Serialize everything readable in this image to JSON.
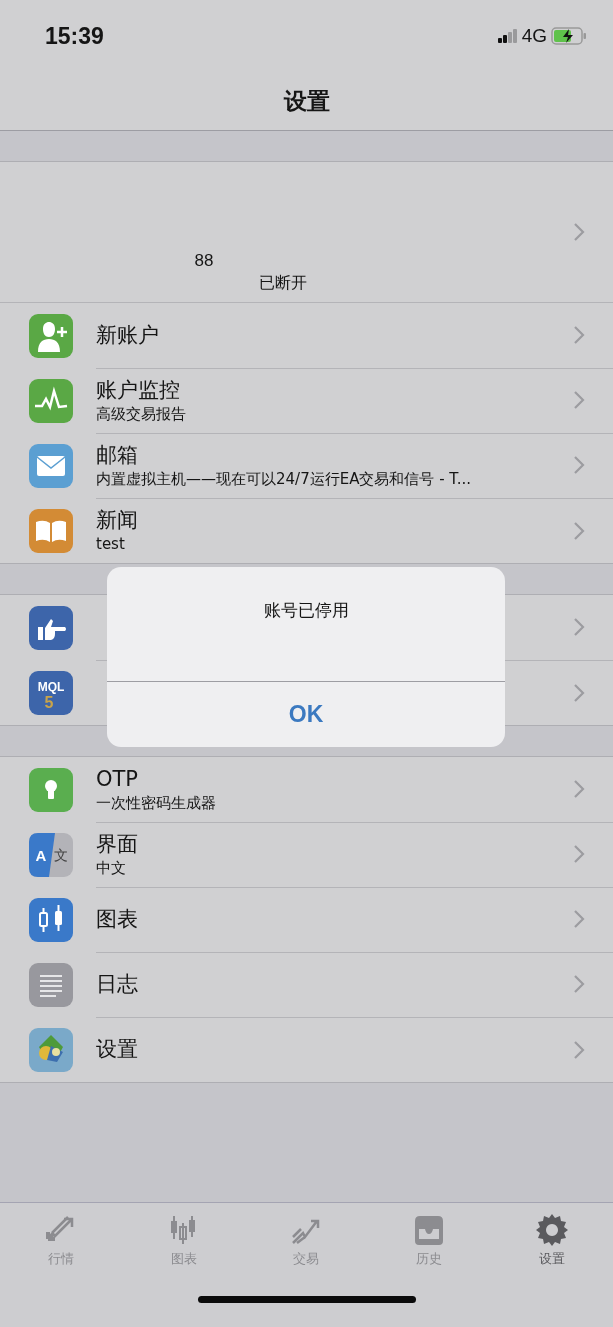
{
  "status_bar": {
    "time": "15:39",
    "network": "4G"
  },
  "nav": {
    "title": "设置"
  },
  "account": {
    "number": "88",
    "status": "已断开"
  },
  "sections": [
    {
      "items": [
        {
          "kind": "person-add",
          "title": "新账户"
        },
        {
          "kind": "monitor",
          "title": "账户监控",
          "subtitle": "高级交易报告"
        },
        {
          "kind": "mail",
          "title": "邮箱",
          "subtitle": "内置虚拟主机——现在可以24/7运行EA交易和信号 - T..."
        },
        {
          "kind": "book",
          "title": "新闻",
          "subtitle": "test"
        }
      ]
    },
    {
      "items": [
        {
          "kind": "thumb"
        },
        {
          "kind": "mql5",
          "logo_lines": [
            "MQL",
            "5"
          ]
        }
      ]
    },
    {
      "items": [
        {
          "kind": "keyhole",
          "title": "OTP",
          "subtitle": "一次性密码生成器"
        },
        {
          "kind": "translate",
          "logo_lines": [
            "A",
            "文"
          ],
          "title": "界面",
          "subtitle": "中文"
        },
        {
          "kind": "candles",
          "title": "图表"
        },
        {
          "kind": "log",
          "title": "日志"
        },
        {
          "kind": "app",
          "title": "设置"
        }
      ]
    }
  ],
  "dialog": {
    "message": "账号已停用",
    "button": "OK"
  },
  "tabs": [
    {
      "kind": "quotes",
      "label": "行情",
      "selected": false
    },
    {
      "kind": "candles",
      "label": "图表",
      "selected": false
    },
    {
      "kind": "trade",
      "label": "交易",
      "selected": false
    },
    {
      "kind": "inbox",
      "label": "历史",
      "selected": false
    },
    {
      "kind": "gear",
      "label": "设置",
      "selected": true
    }
  ]
}
